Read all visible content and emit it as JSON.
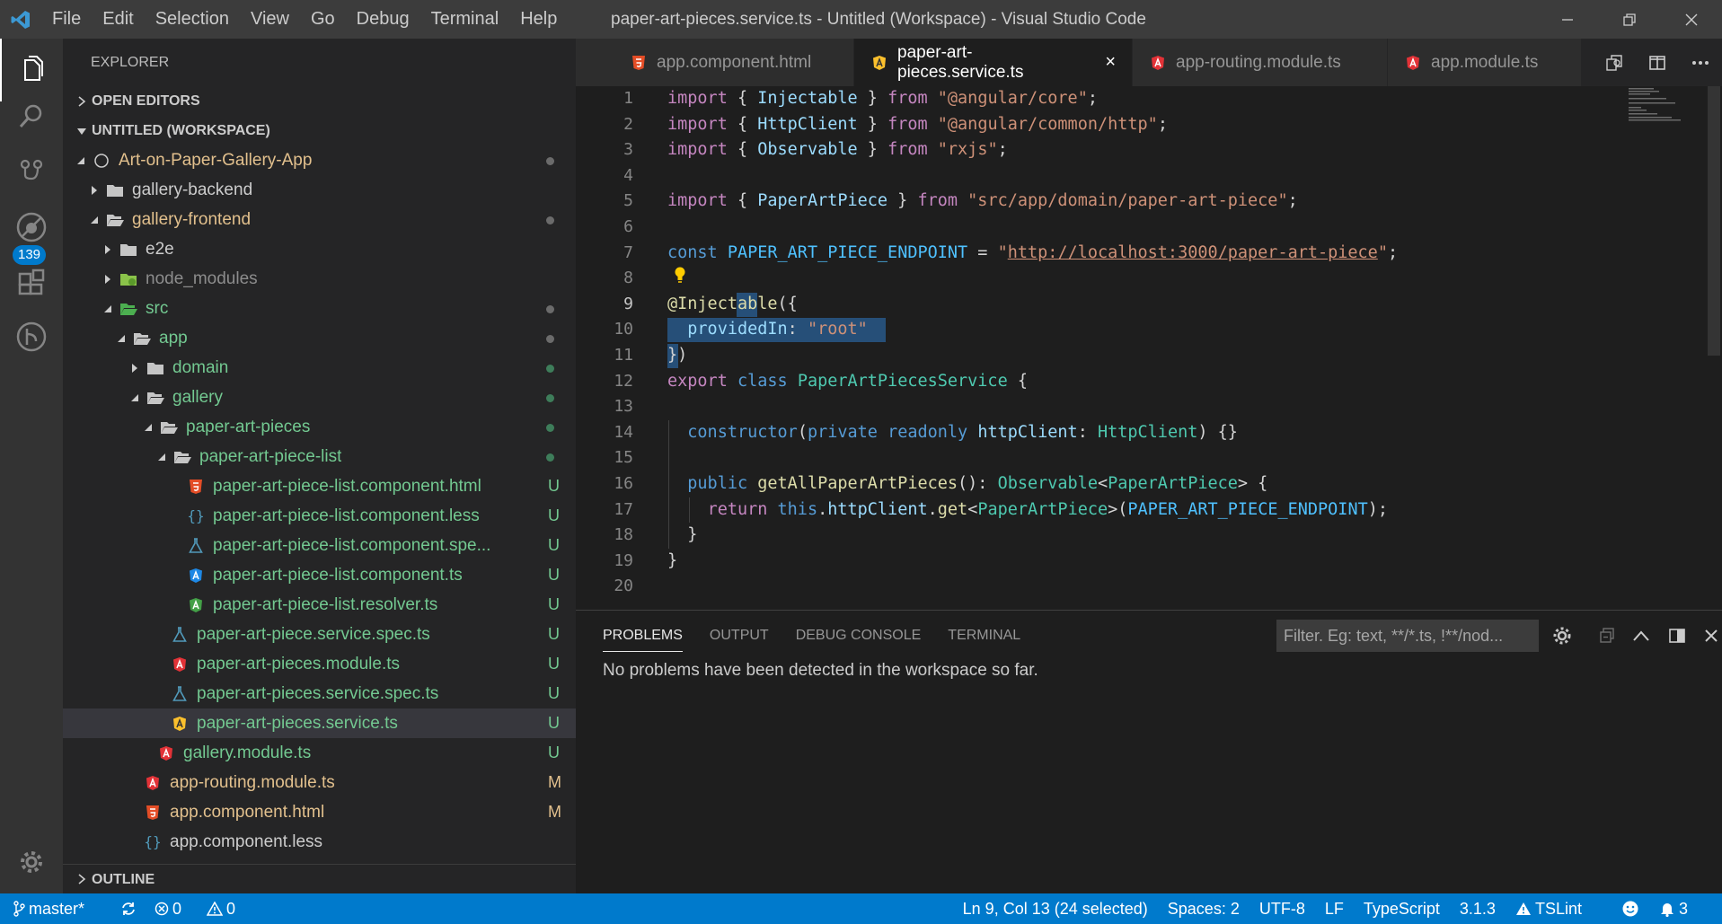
{
  "titlebar": {
    "menu": [
      "File",
      "Edit",
      "Selection",
      "View",
      "Go",
      "Debug",
      "Terminal",
      "Help"
    ],
    "title": "paper-art-pieces.service.ts - Untitled (Workspace) - Visual Studio Code"
  },
  "activity": {
    "scm_badge": "139"
  },
  "sidebar": {
    "title": "EXPLORER",
    "open_editors": "OPEN EDITORS",
    "workspace": "UNTITLED (WORKSPACE)",
    "outline": "OUTLINE",
    "tree": [
      {
        "name": "Art-on-Paper-Gallery-App"
      },
      {
        "name": "gallery-backend"
      },
      {
        "name": "gallery-frontend"
      },
      {
        "name": "e2e"
      },
      {
        "name": "node_modules"
      },
      {
        "name": "src"
      },
      {
        "name": "app"
      },
      {
        "name": "domain"
      },
      {
        "name": "gallery"
      },
      {
        "name": "paper-art-pieces"
      },
      {
        "name": "paper-art-piece-list"
      },
      {
        "name": "paper-art-piece-list.component.html",
        "status": "U"
      },
      {
        "name": "paper-art-piece-list.component.less",
        "status": "U"
      },
      {
        "name": "paper-art-piece-list.component.spe...",
        "status": "U"
      },
      {
        "name": "paper-art-piece-list.component.ts",
        "status": "U"
      },
      {
        "name": "paper-art-piece-list.resolver.ts",
        "status": "U"
      },
      {
        "name": "paper-art-piece.service.spec.ts",
        "status": "U"
      },
      {
        "name": "paper-art-pieces.module.ts",
        "status": "U"
      },
      {
        "name": "paper-art-pieces.service.spec.ts",
        "status": "U"
      },
      {
        "name": "paper-art-pieces.service.ts",
        "status": "U"
      },
      {
        "name": "gallery.module.ts",
        "status": "U"
      },
      {
        "name": "app-routing.module.ts",
        "status": "M"
      },
      {
        "name": "app.component.html",
        "status": "M"
      },
      {
        "name": "app.component.less"
      }
    ]
  },
  "tabs": [
    {
      "label": "app.component.html"
    },
    {
      "label": "paper-art-pieces.service.ts",
      "close": "×"
    },
    {
      "label": "app-routing.module.ts"
    },
    {
      "label": "app.module.ts"
    }
  ],
  "editor": {
    "line_numbers": [
      "1",
      "2",
      "3",
      "4",
      "5",
      "6",
      "7",
      "8",
      "9",
      "10",
      "11",
      "12",
      "13",
      "14",
      "15",
      "16",
      "17",
      "18",
      "19",
      "20"
    ]
  },
  "panel": {
    "tabs": [
      "PROBLEMS",
      "OUTPUT",
      "DEBUG CONSOLE",
      "TERMINAL"
    ],
    "filter_placeholder": "Filter. Eg: text, **/*.ts, !**/nod...",
    "message": "No problems have been detected in the workspace so far."
  },
  "status": {
    "branch": "master*",
    "errors": "0",
    "warnings": "0",
    "position": "Ln 9, Col 13 (24 selected)",
    "spaces": "Spaces: 2",
    "encoding": "UTF-8",
    "eol": "LF",
    "language": "TypeScript",
    "version": "3.1.3",
    "linter": "TSLint",
    "notifications": "3"
  },
  "colors": {
    "accent": "#007acc",
    "angular": "#e23237",
    "git_untracked": "#73c991",
    "git_modified": "#e2c08d"
  }
}
